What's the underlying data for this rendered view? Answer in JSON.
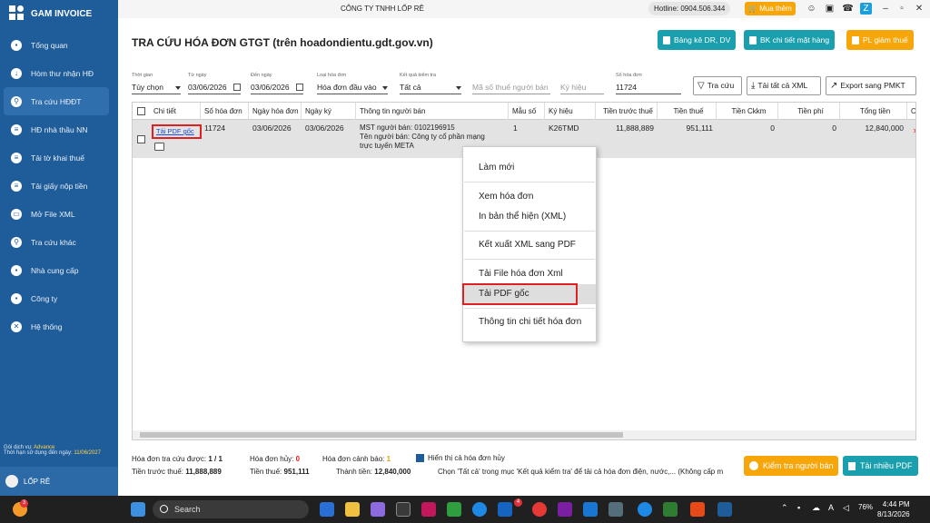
{
  "app": {
    "name": "GAM INVOICE",
    "company": "CÔNG TY TNHH LỐP RÊ",
    "hotline": "Hotline: 0904.506.344",
    "buy_label": "Mua thêm"
  },
  "sidebar": {
    "items": [
      {
        "label": "Tổng quan",
        "icon": "monitor-icon"
      },
      {
        "label": "Hòm thư nhận HĐ",
        "icon": "inbox-icon"
      },
      {
        "label": "Tra cứu HĐĐT",
        "icon": "search-invoice-icon",
        "active": true
      },
      {
        "label": "HĐ nhà thầu NN",
        "icon": "contract-icon"
      },
      {
        "label": "Tải tờ khai thuế",
        "icon": "tax-form-icon"
      },
      {
        "label": "Tải giấy nộp tiền",
        "icon": "payment-doc-icon"
      },
      {
        "label": "Mở File XML",
        "icon": "folder-icon"
      },
      {
        "label": "Tra cứu khác",
        "icon": "magnifier-icon"
      },
      {
        "label": "Nhà cung cấp",
        "icon": "supplier-icon"
      },
      {
        "label": "Công ty",
        "icon": "company-icon"
      },
      {
        "label": "Hệ thống",
        "icon": "settings-icon"
      }
    ],
    "service_label": "Gói dịch vụ:",
    "service_value": "Advance",
    "expiry_label": "Thời hạn sử dụng đến ngày:",
    "expiry_value": "11/06/2027",
    "user": "LỐP RÊ"
  },
  "header": {
    "title": "TRA CỨU HÓA ĐƠN GTGT (trên hoadondientu.gdt.gov.vn)",
    "btn_bangke": "Bảng kê DR, DV",
    "btn_bk_chitiet": "BK chi tiết mặt hàng",
    "btn_pl_giamthue": "PL giảm thuế"
  },
  "filters": {
    "thoi_gian_label": "Thời gian",
    "thoi_gian": "Tùy chọn",
    "tu_ngay_label": "Từ ngày",
    "tu_ngay": "03/06/2026",
    "den_ngay_label": "Đến ngày",
    "den_ngay": "03/06/2026",
    "loai_hd_label": "Loại hóa đơn",
    "loai_hd": "Hóa đơn đầu vào",
    "ket_qua_label": "Kết quả kiểm tra",
    "ket_qua": "Tất cả",
    "mst_placeholder": "Mã số thuế người bán",
    "ky_hieu_placeholder": "Ký hiệu",
    "so_hd_label": "Số hóa đơn",
    "so_hd": "11724",
    "btn_tra_cuu": "Tra cứu",
    "btn_tai_xml": "Tải tất cả XML",
    "btn_export": "Export sang PMKT"
  },
  "table": {
    "headers": [
      "Chi tiết",
      "Số hóa đơn",
      "Ngày hóa đơn",
      "Ngày ký",
      "Thông tin người bán",
      "Mẫu số",
      "Ký hiệu",
      "Tiền trước thuế",
      "Tiền thuế",
      "Tiền Ckkm",
      "Tiền phí",
      "Tổng tiền",
      "C"
    ],
    "row": {
      "link": "Tải PDF gốc",
      "so_hd": "11724",
      "ngay_hd": "03/06/2026",
      "ngay_ky": "03/06/2026",
      "seller_1": "MST người bán: 0102196915",
      "seller_2": "Tên người bán: Công ty cổ phần mạng",
      "seller_3": "trực tuyến META",
      "mau_so": "1",
      "ky_hieu": "K26TMD",
      "tien_truoc_thue": "11,888,889",
      "tien_thue": "951,111",
      "tien_ckkm": "0",
      "tien_phi": "0",
      "tong_tien": "12,840,000"
    }
  },
  "context_menu": {
    "items": [
      "Làm mới",
      "Xem hóa đơn",
      "In bản thể hiện (XML)",
      "Kết xuất XML sang PDF",
      "Tải File hóa đơn Xml",
      "Tải PDF gốc",
      "Thông tin chi tiết hóa đơn"
    ]
  },
  "footer": {
    "tra_cuu_label": "Hóa đơn tra cứu được:",
    "tra_cuu_val": "1 / 1",
    "huy_label": "Hóa đơn hủy:",
    "huy_val": "0",
    "canh_bao_label": "Hóa đơn cảnh báo:",
    "canh_bao_val": "1",
    "hien_thi_label": "Hiển thị cả hóa đơn hủy",
    "truoc_thue_label": "Tiền trước thuế:",
    "truoc_thue_val": "11,888,889",
    "tien_thue_label": "Tiền thuế:",
    "tien_thue_val": "951,111",
    "thanh_tien_label": "Thành tiền:",
    "thanh_tien_val": "12,840,000",
    "warning": "Chọn 'Tất cả' trong mục 'Kết quả kiểm tra' để tải cả hóa đơn điện, nước,... (Không cấp m",
    "btn_kiem_tra": "Kiểm tra người bán",
    "btn_tai_pdf": "Tải nhiều PDF"
  },
  "taskbar": {
    "search": "Search",
    "time": "4:44 PM",
    "date": "8/13/2026",
    "battery": "76%",
    "badge_left": "3",
    "badge_app": "4"
  }
}
